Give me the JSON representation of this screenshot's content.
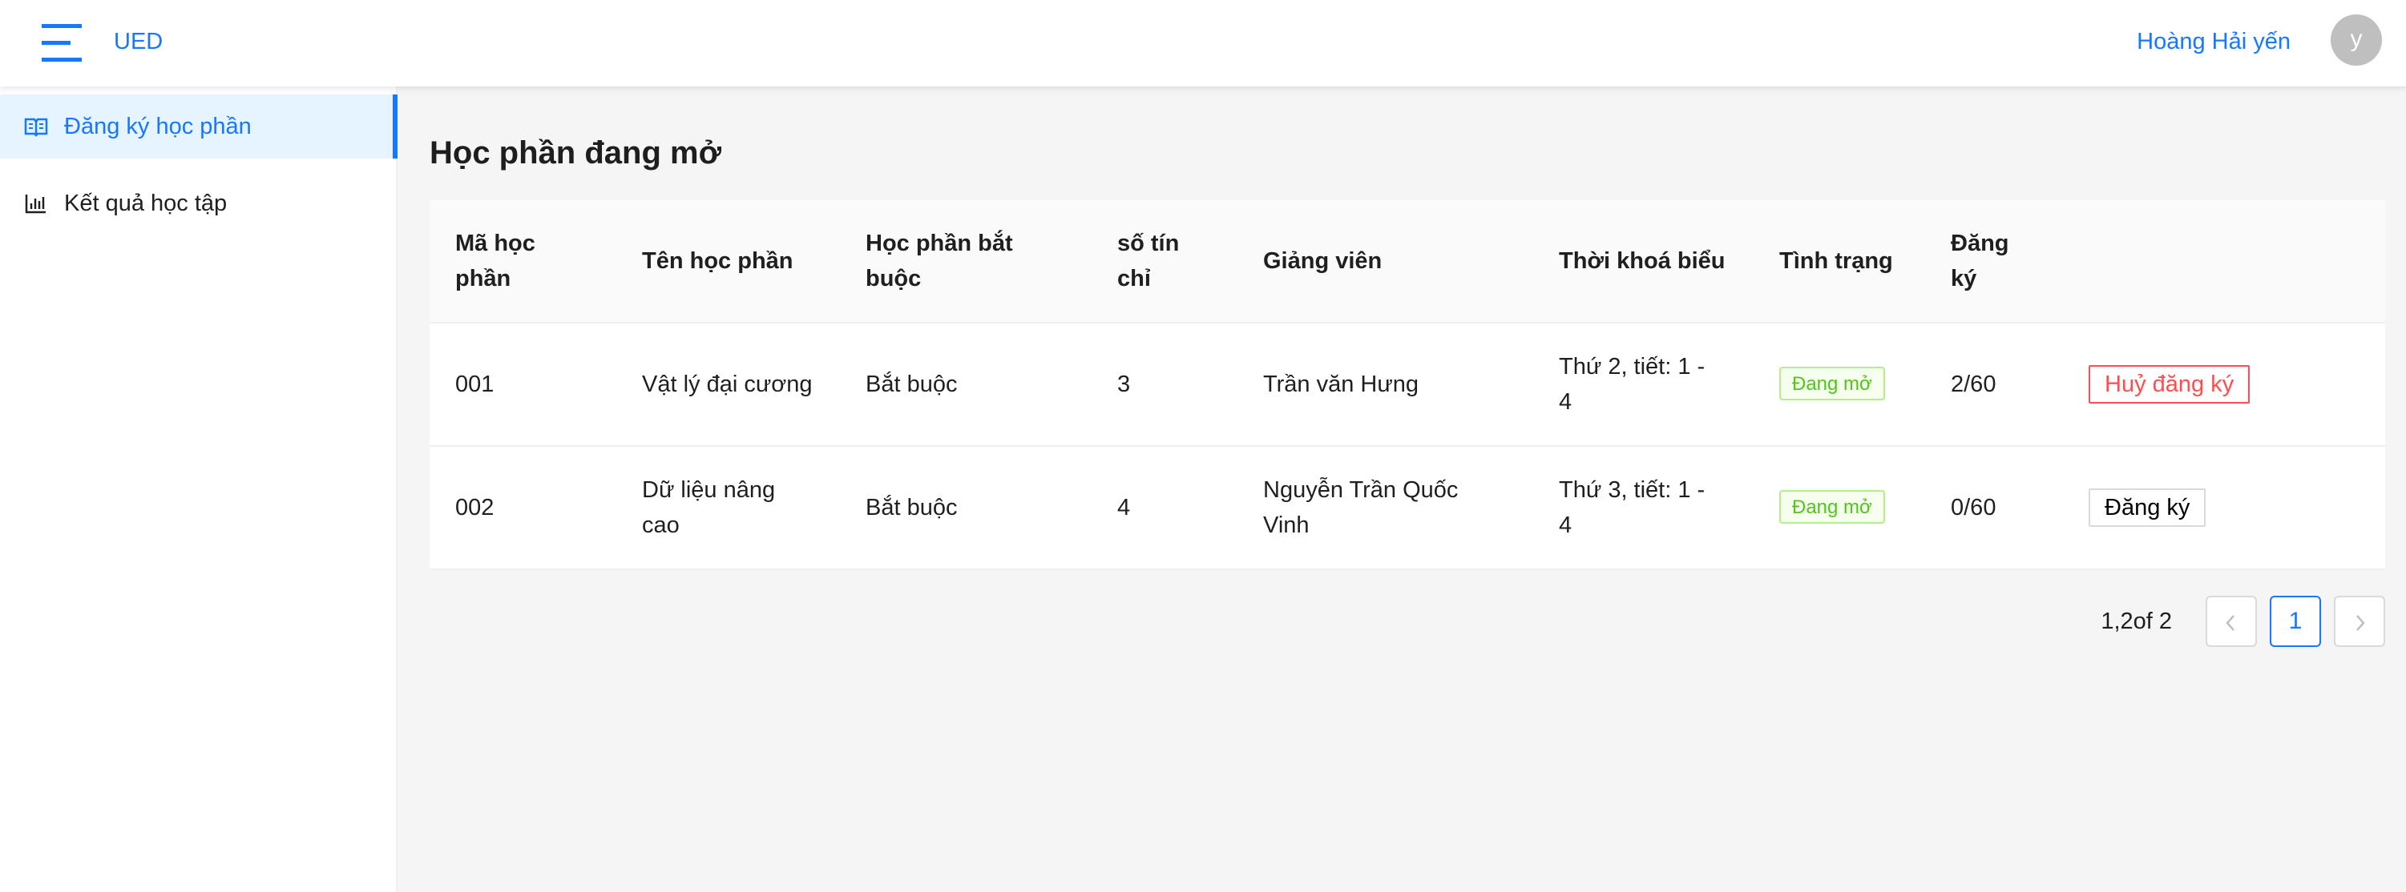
{
  "header": {
    "brand": "UED",
    "user_name": "Hoàng Hải yến",
    "avatar_initial": "y"
  },
  "sidebar": {
    "items": [
      {
        "label": "Đăng ký học phần",
        "icon": "book-open-icon",
        "active": true
      },
      {
        "label": "Kết quả học tập",
        "icon": "bar-chart-icon",
        "active": false
      }
    ]
  },
  "main": {
    "title": "Học phần đang mở",
    "table": {
      "columns": {
        "code": [
          "Mã học",
          "phần"
        ],
        "name": "Tên học phần",
        "required": [
          "Học phần bắt",
          "buộc"
        ],
        "credits": [
          "số tín",
          "chỉ"
        ],
        "lecturer": "Giảng viên",
        "schedule": "Thời khoá biểu",
        "status": "Tình trạng",
        "registered": [
          "Đăng",
          "ký"
        ]
      },
      "rows": [
        {
          "code": "001",
          "name": [
            "Vật lý đại cương"
          ],
          "required": "Bắt buộc",
          "credits": "3",
          "lecturer": [
            "Trần văn Hưng"
          ],
          "schedule": [
            "Thứ 2, tiết: 1 -",
            "4"
          ],
          "status": "Đang mở",
          "registered": "2/60",
          "action": "Huỷ đăng ký"
        },
        {
          "code": "002",
          "name": [
            "Dữ liệu nâng",
            "cao"
          ],
          "required": "Bắt buộc",
          "credits": "4",
          "lecturer": [
            "Nguyễn Trần Quốc",
            "Vinh"
          ],
          "schedule": [
            "Thứ 3, tiết: 1 -",
            "4"
          ],
          "status": "Đang mở",
          "registered": "0/60",
          "action": "Đăng ký"
        }
      ]
    },
    "pagination": {
      "total_text": "1,2of 2",
      "current_page": "1"
    }
  },
  "colors": {
    "primary": "#1677ff",
    "danger": "#ff4d4f",
    "success": "#52c41a",
    "background": "#f5f5f5"
  }
}
